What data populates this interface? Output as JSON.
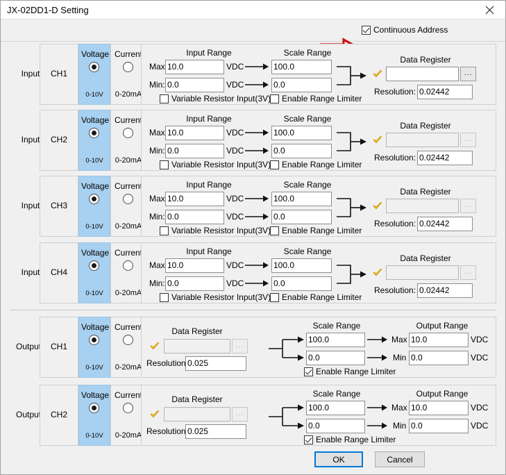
{
  "window": {
    "title": "JX-02DD1-D Setting",
    "close_icon": "close-icon"
  },
  "header": {
    "continuous_address_label": "Continuous Address",
    "continuous_address_checked": true,
    "annotation_arrow": "red-right-arrow-annotation"
  },
  "labels": {
    "input": "Input",
    "output": "Output",
    "voltage": "Voltage",
    "current": "Current",
    "voltage_range": "0-10V",
    "current_range": "0-20mA",
    "input_range": "Input Range",
    "scale_range": "Scale Range",
    "output_range": "Output Range",
    "data_register": "Data Register",
    "resolution": "Resolution:",
    "max_colon": "Max:",
    "min_colon": "Min:",
    "max": "Max",
    "min": "Min",
    "vdc": "VDC",
    "variable_resistor": "Variable Resistor Input(3V)",
    "enable_range_limiter": "Enable Range Limiter",
    "browse": "...",
    "check_icon": "yellow-check-icon"
  },
  "input_rows": [
    {
      "section": "Input",
      "channel": "CH1",
      "mode": "voltage",
      "input_max": "10.0",
      "input_min": "0.0",
      "variable_resistor_checked": false,
      "scale_max": "100.0",
      "scale_min": "0.0",
      "range_limiter_checked": false,
      "data_register": "",
      "data_register_disabled": false,
      "resolution": "0.02442"
    },
    {
      "section": "Input",
      "channel": "CH2",
      "mode": "voltage",
      "input_max": "10.0",
      "input_min": "0.0",
      "variable_resistor_checked": false,
      "scale_max": "100.0",
      "scale_min": "0.0",
      "range_limiter_checked": false,
      "data_register": "",
      "data_register_disabled": true,
      "resolution": "0.02442"
    },
    {
      "section": "Input",
      "channel": "CH3",
      "mode": "voltage",
      "input_max": "10.0",
      "input_min": "0.0",
      "variable_resistor_checked": false,
      "scale_max": "100.0",
      "scale_min": "0.0",
      "range_limiter_checked": false,
      "data_register": "",
      "data_register_disabled": true,
      "resolution": "0.02442"
    },
    {
      "section": "Input",
      "channel": "CH4",
      "mode": "voltage",
      "input_max": "10.0",
      "input_min": "0.0",
      "variable_resistor_checked": false,
      "scale_max": "100.0",
      "scale_min": "0.0",
      "range_limiter_checked": false,
      "data_register": "",
      "data_register_disabled": true,
      "resolution": "0.02442"
    }
  ],
  "output_rows": [
    {
      "section": "Output",
      "channel": "CH1",
      "mode": "voltage",
      "data_register": "",
      "data_register_disabled": true,
      "resolution": "0.025",
      "scale_max": "100.0",
      "scale_min": "0.0",
      "range_limiter_checked": true,
      "output_max": "10.0",
      "output_min": "0.0"
    },
    {
      "section": "Output",
      "channel": "CH2",
      "mode": "voltage",
      "data_register": "",
      "data_register_disabled": true,
      "resolution": "0.025",
      "scale_max": "100.0",
      "scale_min": "0.0",
      "range_limiter_checked": true,
      "output_max": "10.0",
      "output_min": "0.0"
    }
  ],
  "footer": {
    "ok_label": "OK",
    "cancel_label": "Cancel"
  },
  "colors": {
    "accent": "#0078d7",
    "voltage_highlight": "#a8d0f0",
    "annotation_red": "#cc1111",
    "check_yellow": "#e8b423",
    "window_bg": "#f0f0f0"
  }
}
